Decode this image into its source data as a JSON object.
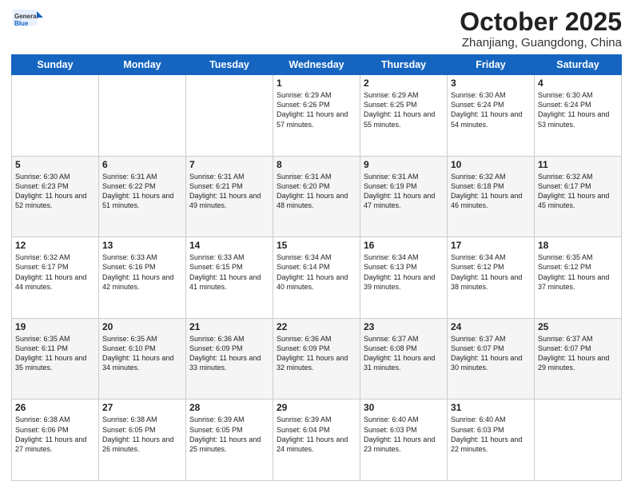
{
  "logo": {
    "general": "General",
    "blue": "Blue"
  },
  "header": {
    "month": "October 2025",
    "location": "Zhanjiang, Guangdong, China"
  },
  "weekdays": [
    "Sunday",
    "Monday",
    "Tuesday",
    "Wednesday",
    "Thursday",
    "Friday",
    "Saturday"
  ],
  "weeks": [
    [
      {
        "day": "",
        "sunrise": "",
        "sunset": "",
        "daylight": ""
      },
      {
        "day": "",
        "sunrise": "",
        "sunset": "",
        "daylight": ""
      },
      {
        "day": "",
        "sunrise": "",
        "sunset": "",
        "daylight": ""
      },
      {
        "day": "1",
        "sunrise": "Sunrise: 6:29 AM",
        "sunset": "Sunset: 6:26 PM",
        "daylight": "Daylight: 11 hours and 57 minutes."
      },
      {
        "day": "2",
        "sunrise": "Sunrise: 6:29 AM",
        "sunset": "Sunset: 6:25 PM",
        "daylight": "Daylight: 11 hours and 55 minutes."
      },
      {
        "day": "3",
        "sunrise": "Sunrise: 6:30 AM",
        "sunset": "Sunset: 6:24 PM",
        "daylight": "Daylight: 11 hours and 54 minutes."
      },
      {
        "day": "4",
        "sunrise": "Sunrise: 6:30 AM",
        "sunset": "Sunset: 6:24 PM",
        "daylight": "Daylight: 11 hours and 53 minutes."
      }
    ],
    [
      {
        "day": "5",
        "sunrise": "Sunrise: 6:30 AM",
        "sunset": "Sunset: 6:23 PM",
        "daylight": "Daylight: 11 hours and 52 minutes."
      },
      {
        "day": "6",
        "sunrise": "Sunrise: 6:31 AM",
        "sunset": "Sunset: 6:22 PM",
        "daylight": "Daylight: 11 hours and 51 minutes."
      },
      {
        "day": "7",
        "sunrise": "Sunrise: 6:31 AM",
        "sunset": "Sunset: 6:21 PM",
        "daylight": "Daylight: 11 hours and 49 minutes."
      },
      {
        "day": "8",
        "sunrise": "Sunrise: 6:31 AM",
        "sunset": "Sunset: 6:20 PM",
        "daylight": "Daylight: 11 hours and 48 minutes."
      },
      {
        "day": "9",
        "sunrise": "Sunrise: 6:31 AM",
        "sunset": "Sunset: 6:19 PM",
        "daylight": "Daylight: 11 hours and 47 minutes."
      },
      {
        "day": "10",
        "sunrise": "Sunrise: 6:32 AM",
        "sunset": "Sunset: 6:18 PM",
        "daylight": "Daylight: 11 hours and 46 minutes."
      },
      {
        "day": "11",
        "sunrise": "Sunrise: 6:32 AM",
        "sunset": "Sunset: 6:17 PM",
        "daylight": "Daylight: 11 hours and 45 minutes."
      }
    ],
    [
      {
        "day": "12",
        "sunrise": "Sunrise: 6:32 AM",
        "sunset": "Sunset: 6:17 PM",
        "daylight": "Daylight: 11 hours and 44 minutes."
      },
      {
        "day": "13",
        "sunrise": "Sunrise: 6:33 AM",
        "sunset": "Sunset: 6:16 PM",
        "daylight": "Daylight: 11 hours and 42 minutes."
      },
      {
        "day": "14",
        "sunrise": "Sunrise: 6:33 AM",
        "sunset": "Sunset: 6:15 PM",
        "daylight": "Daylight: 11 hours and 41 minutes."
      },
      {
        "day": "15",
        "sunrise": "Sunrise: 6:34 AM",
        "sunset": "Sunset: 6:14 PM",
        "daylight": "Daylight: 11 hours and 40 minutes."
      },
      {
        "day": "16",
        "sunrise": "Sunrise: 6:34 AM",
        "sunset": "Sunset: 6:13 PM",
        "daylight": "Daylight: 11 hours and 39 minutes."
      },
      {
        "day": "17",
        "sunrise": "Sunrise: 6:34 AM",
        "sunset": "Sunset: 6:12 PM",
        "daylight": "Daylight: 11 hours and 38 minutes."
      },
      {
        "day": "18",
        "sunrise": "Sunrise: 6:35 AM",
        "sunset": "Sunset: 6:12 PM",
        "daylight": "Daylight: 11 hours and 37 minutes."
      }
    ],
    [
      {
        "day": "19",
        "sunrise": "Sunrise: 6:35 AM",
        "sunset": "Sunset: 6:11 PM",
        "daylight": "Daylight: 11 hours and 35 minutes."
      },
      {
        "day": "20",
        "sunrise": "Sunrise: 6:35 AM",
        "sunset": "Sunset: 6:10 PM",
        "daylight": "Daylight: 11 hours and 34 minutes."
      },
      {
        "day": "21",
        "sunrise": "Sunrise: 6:36 AM",
        "sunset": "Sunset: 6:09 PM",
        "daylight": "Daylight: 11 hours and 33 minutes."
      },
      {
        "day": "22",
        "sunrise": "Sunrise: 6:36 AM",
        "sunset": "Sunset: 6:09 PM",
        "daylight": "Daylight: 11 hours and 32 minutes."
      },
      {
        "day": "23",
        "sunrise": "Sunrise: 6:37 AM",
        "sunset": "Sunset: 6:08 PM",
        "daylight": "Daylight: 11 hours and 31 minutes."
      },
      {
        "day": "24",
        "sunrise": "Sunrise: 6:37 AM",
        "sunset": "Sunset: 6:07 PM",
        "daylight": "Daylight: 11 hours and 30 minutes."
      },
      {
        "day": "25",
        "sunrise": "Sunrise: 6:37 AM",
        "sunset": "Sunset: 6:07 PM",
        "daylight": "Daylight: 11 hours and 29 minutes."
      }
    ],
    [
      {
        "day": "26",
        "sunrise": "Sunrise: 6:38 AM",
        "sunset": "Sunset: 6:06 PM",
        "daylight": "Daylight: 11 hours and 27 minutes."
      },
      {
        "day": "27",
        "sunrise": "Sunrise: 6:38 AM",
        "sunset": "Sunset: 6:05 PM",
        "daylight": "Daylight: 11 hours and 26 minutes."
      },
      {
        "day": "28",
        "sunrise": "Sunrise: 6:39 AM",
        "sunset": "Sunset: 6:05 PM",
        "daylight": "Daylight: 11 hours and 25 minutes."
      },
      {
        "day": "29",
        "sunrise": "Sunrise: 6:39 AM",
        "sunset": "Sunset: 6:04 PM",
        "daylight": "Daylight: 11 hours and 24 minutes."
      },
      {
        "day": "30",
        "sunrise": "Sunrise: 6:40 AM",
        "sunset": "Sunset: 6:03 PM",
        "daylight": "Daylight: 11 hours and 23 minutes."
      },
      {
        "day": "31",
        "sunrise": "Sunrise: 6:40 AM",
        "sunset": "Sunset: 6:03 PM",
        "daylight": "Daylight: 11 hours and 22 minutes."
      },
      {
        "day": "",
        "sunrise": "",
        "sunset": "",
        "daylight": ""
      }
    ]
  ]
}
